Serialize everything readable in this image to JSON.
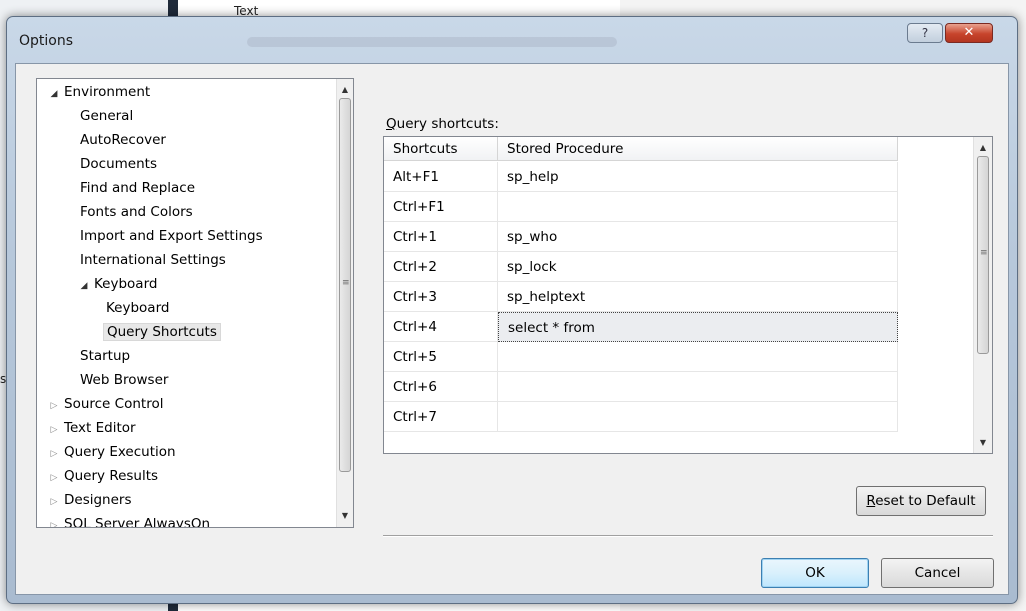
{
  "background": {
    "header_text": "Text",
    "side_text": "s"
  },
  "window": {
    "title": "Options",
    "help_label": "?",
    "close_label": "✕"
  },
  "tree": {
    "items": [
      {
        "label": "Environment",
        "level": 0,
        "state": "expanded"
      },
      {
        "label": "General",
        "level": 1,
        "state": "leaf"
      },
      {
        "label": "AutoRecover",
        "level": 1,
        "state": "leaf"
      },
      {
        "label": "Documents",
        "level": 1,
        "state": "leaf"
      },
      {
        "label": "Find and Replace",
        "level": 1,
        "state": "leaf"
      },
      {
        "label": "Fonts and Colors",
        "level": 1,
        "state": "leaf"
      },
      {
        "label": "Import and Export Settings",
        "level": 1,
        "state": "leaf"
      },
      {
        "label": "International Settings",
        "level": 1,
        "state": "leaf"
      },
      {
        "label": "Keyboard",
        "level": 1,
        "state": "expanded"
      },
      {
        "label": "Keyboard",
        "level": 2,
        "state": "leaf"
      },
      {
        "label": "Query Shortcuts",
        "level": 2,
        "state": "selected"
      },
      {
        "label": "Startup",
        "level": 1,
        "state": "leaf"
      },
      {
        "label": "Web Browser",
        "level": 1,
        "state": "leaf"
      },
      {
        "label": "Source Control",
        "level": 0,
        "state": "collapsed"
      },
      {
        "label": "Text Editor",
        "level": 0,
        "state": "collapsed"
      },
      {
        "label": "Query Execution",
        "level": 0,
        "state": "collapsed"
      },
      {
        "label": "Query Results",
        "level": 0,
        "state": "collapsed"
      },
      {
        "label": "Designers",
        "level": 0,
        "state": "collapsed"
      },
      {
        "label": "SQL Server AlwaysOn",
        "level": 0,
        "state": "collapsed"
      }
    ]
  },
  "panel": {
    "label_mnemonic": "Q",
    "label_rest": "uery shortcuts:",
    "columns": [
      "Shortcuts",
      "Stored Procedure"
    ],
    "rows": [
      {
        "shortcut": "Alt+F1",
        "procedure": "sp_help"
      },
      {
        "shortcut": "Ctrl+F1",
        "procedure": ""
      },
      {
        "shortcut": "Ctrl+1",
        "procedure": "sp_who"
      },
      {
        "shortcut": "Ctrl+2",
        "procedure": "sp_lock"
      },
      {
        "shortcut": "Ctrl+3",
        "procedure": "sp_helptext"
      },
      {
        "shortcut": "Ctrl+4",
        "procedure": "select * from",
        "focused": true
      },
      {
        "shortcut": "Ctrl+5",
        "procedure": ""
      },
      {
        "shortcut": "Ctrl+6",
        "procedure": ""
      },
      {
        "shortcut": "Ctrl+7",
        "procedure": ""
      }
    ]
  },
  "buttons": {
    "reset_mnemonic": "R",
    "reset_rest": "eset to Default",
    "ok": "OK",
    "cancel": "Cancel"
  }
}
